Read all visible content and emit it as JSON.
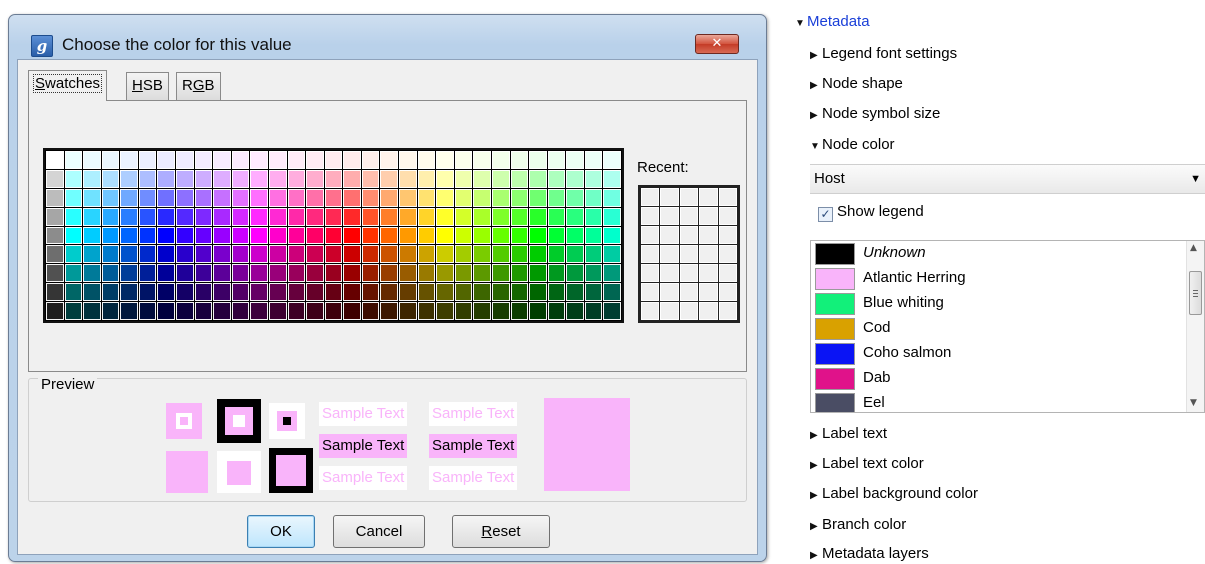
{
  "dialog": {
    "title": "Choose the color for this value",
    "app_icon": "g",
    "close_label": "✕",
    "tabs": [
      {
        "label": "Swatches",
        "mnemonic": "S",
        "active": true
      },
      {
        "label": "HSB",
        "mnemonic": "H",
        "active": false
      },
      {
        "label": "RGB",
        "mnemonic": "G",
        "active": false
      }
    ],
    "recent_label": "Recent:",
    "preview": {
      "legend": "Preview",
      "sample_text": "Sample Text",
      "color": "#f9b4fa",
      "dark": "#000000"
    },
    "buttons": {
      "ok": "OK",
      "cancel": "Cancel",
      "reset": "Reset"
    }
  },
  "side_panel": {
    "metadata_label": "Metadata",
    "sections_top": [
      "Legend font settings",
      "Node shape",
      "Node symbol size"
    ],
    "node_color_label": "Node color",
    "dropdown_value": "Host",
    "show_legend_label": "Show legend",
    "show_legend_checked": true,
    "legend_items": [
      {
        "label": "Unknown",
        "color": "#000000",
        "italic": true
      },
      {
        "label": "Atlantic Herring",
        "color": "#f9b4fa",
        "italic": false
      },
      {
        "label": "Blue whiting",
        "color": "#12f07a",
        "italic": false
      },
      {
        "label": "Cod",
        "color": "#d9a100",
        "italic": false
      },
      {
        "label": "Coho salmon",
        "color": "#0a14f5",
        "italic": false
      },
      {
        "label": "Dab",
        "color": "#e0128a",
        "italic": false
      },
      {
        "label": "Eel",
        "color": "#4a4d64",
        "italic": false
      }
    ],
    "sections_bottom": [
      "Label text",
      "Label text color",
      "Label background color",
      "Branch color",
      "Metadata layers"
    ]
  }
}
